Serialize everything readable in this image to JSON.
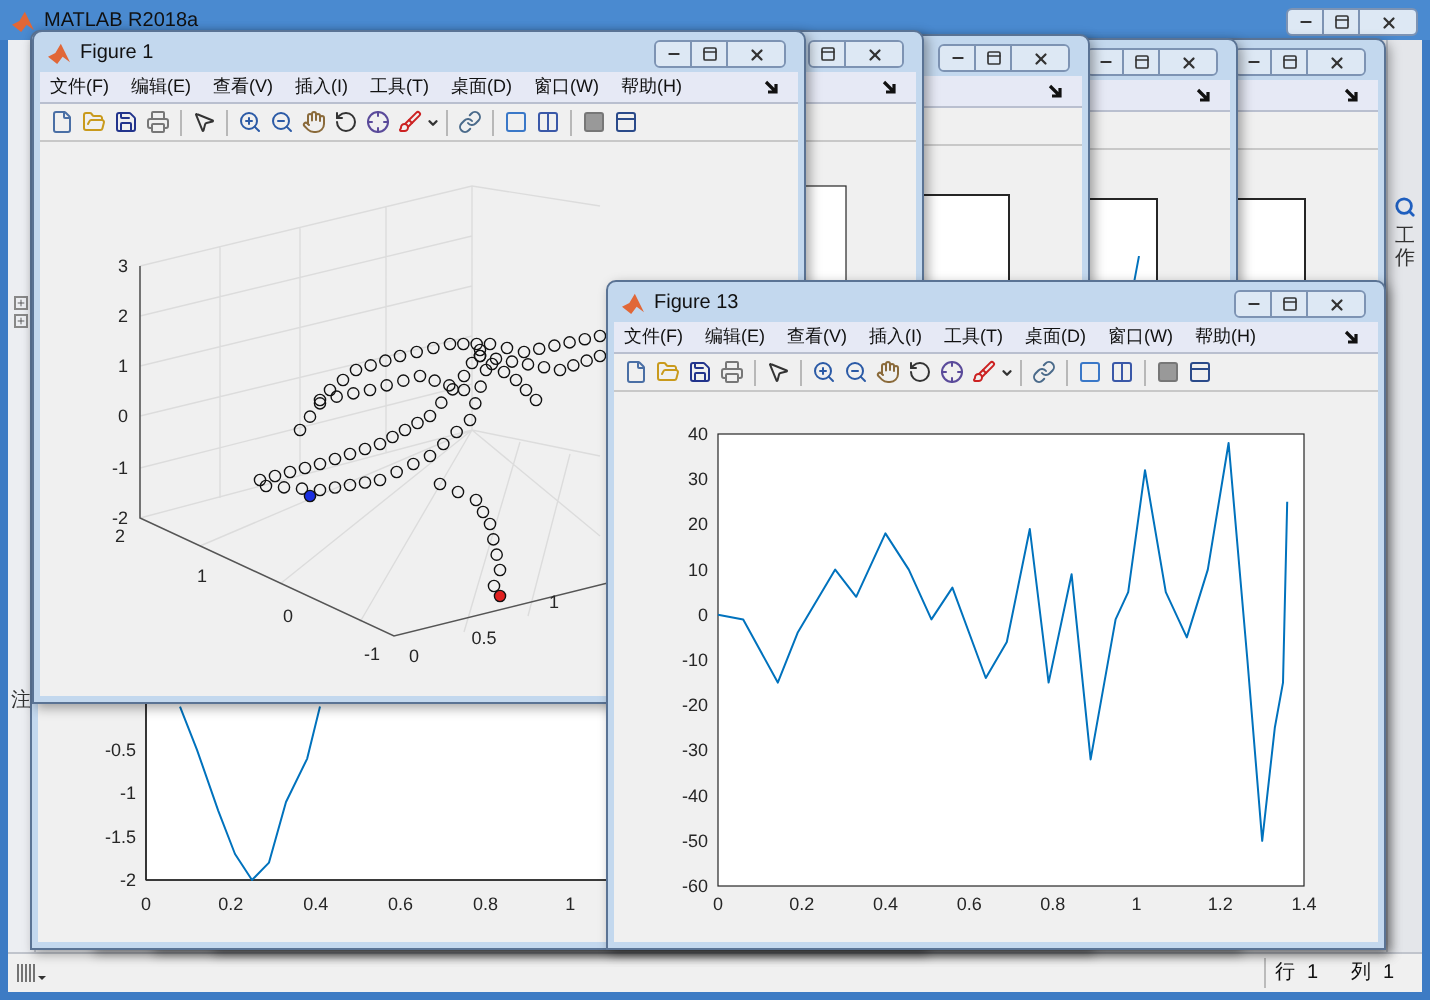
{
  "main_window": {
    "title": "MATLAB R2018a"
  },
  "left_panel": {
    "label": "注"
  },
  "side_panel": {
    "label": "工作"
  },
  "background_figures": [
    {
      "kind": "axes"
    },
    {
      "kind": "axes_trace"
    },
    {
      "kind": "axes"
    },
    {
      "kind": "chart",
      "chart_data": {
        "type": "line",
        "x": [
          0.08,
          0.12,
          0.17,
          0.21,
          0.25,
          0.29,
          0.33,
          0.38,
          0.41
        ],
        "series": [
          {
            "color": "#0072bd",
            "values": [
              0,
              -0.5,
              -1.2,
              -1.7,
              -2,
              -1.8,
              -1.1,
              -0.6,
              0
            ]
          }
        ],
        "xlim": [
          0,
          1.65
        ],
        "ylim": [
          -2,
          6
        ],
        "xticks": [
          0,
          0.2,
          0.4,
          0.6,
          0.8,
          1
        ],
        "yticks": [
          -2,
          -1.5,
          -1,
          -0.5
        ]
      }
    }
  ],
  "scatter_figure": {
    "title": "Figure 1",
    "menu": [
      "文件(F)",
      "编辑(E)",
      "查看(V)",
      "插入(I)",
      "工具(T)",
      "桌面(D)",
      "窗口(W)",
      "帮助(H)"
    ],
    "plot": {
      "kind": "scatter3d",
      "z_ticks": [
        "3",
        "2",
        "1",
        "0",
        "-1",
        "-2"
      ],
      "y_ticks": [
        "2",
        "1",
        "0",
        "-1"
      ],
      "x_ticks": [
        "0",
        "0.5",
        "1"
      ]
    }
  },
  "line_figure": {
    "title": "Figure 13",
    "menu": [
      "文件(F)",
      "编辑(E)",
      "查看(V)",
      "插入(I)",
      "工具(T)",
      "桌面(D)",
      "窗口(W)",
      "帮助(H)"
    ],
    "chart_data": {
      "type": "line",
      "x": [
        0,
        0.06,
        0.143,
        0.19,
        0.28,
        0.33,
        0.4,
        0.456,
        0.51,
        0.56,
        0.64,
        0.69,
        0.745,
        0.79,
        0.845,
        0.89,
        0.95,
        0.98,
        1.02,
        1.07,
        1.12,
        1.17,
        1.22,
        1.265,
        1.3,
        1.33,
        1.35,
        1.36
      ],
      "series": [
        {
          "color": "#0072bd",
          "values": [
            0,
            -1,
            -15,
            -4,
            10,
            4,
            18,
            10,
            -1,
            6,
            -14,
            -6,
            19,
            -15,
            9,
            -32,
            -1,
            5,
            32,
            5,
            -5,
            10,
            38,
            -10,
            -50,
            -25,
            -15,
            25
          ]
        }
      ],
      "xlim": [
        0,
        1.4
      ],
      "ylim": [
        -60,
        40
      ],
      "xticks": [
        0,
        0.2,
        0.4,
        0.6,
        0.8,
        1,
        1.2,
        1.4
      ],
      "yticks": [
        -60,
        -50,
        -40,
        -30,
        -20,
        -10,
        0,
        10,
        20,
        30,
        40
      ]
    }
  },
  "status_bar": {
    "row_label": "行",
    "row_value": "1",
    "col_label": "列",
    "col_value": "1"
  }
}
